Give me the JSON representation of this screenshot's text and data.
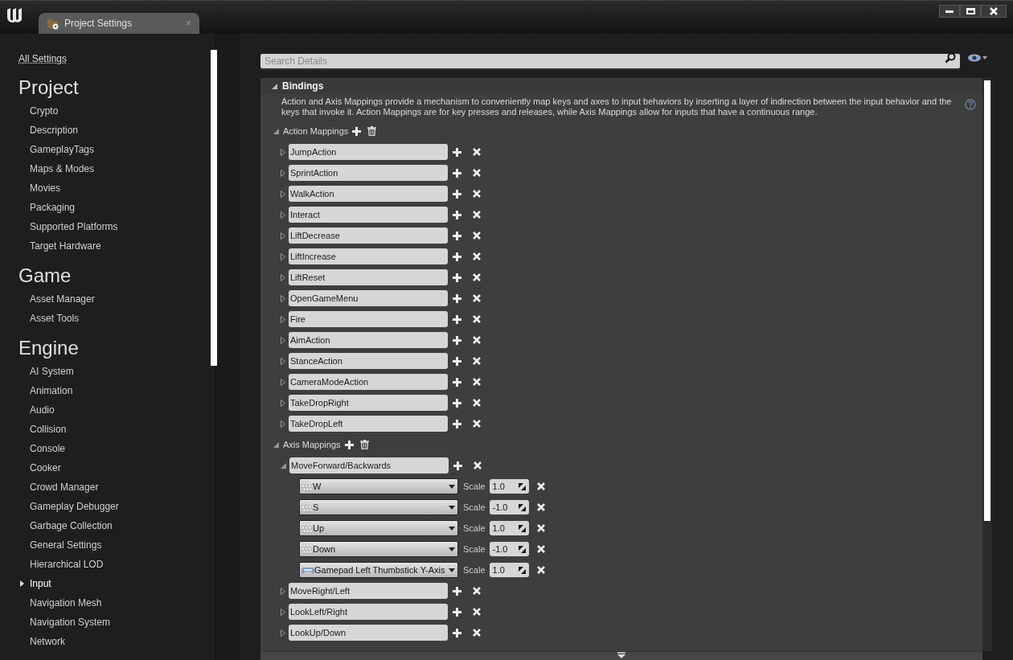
{
  "window": {
    "tab_title": "Project Settings",
    "tab_close": "×"
  },
  "sidebar": {
    "all_settings": "All Settings",
    "sections": [
      {
        "title": "Project",
        "items": [
          {
            "label": "Crypto",
            "selected": false
          },
          {
            "label": "Description",
            "selected": false
          },
          {
            "label": "GameplayTags",
            "selected": false
          },
          {
            "label": "Maps & Modes",
            "selected": false
          },
          {
            "label": "Movies",
            "selected": false
          },
          {
            "label": "Packaging",
            "selected": false
          },
          {
            "label": "Supported Platforms",
            "selected": false
          },
          {
            "label": "Target Hardware",
            "selected": false
          }
        ]
      },
      {
        "title": "Game",
        "items": [
          {
            "label": "Asset Manager",
            "selected": false
          },
          {
            "label": "Asset Tools",
            "selected": false
          }
        ]
      },
      {
        "title": "Engine",
        "items": [
          {
            "label": "AI System",
            "selected": false
          },
          {
            "label": "Animation",
            "selected": false
          },
          {
            "label": "Audio",
            "selected": false
          },
          {
            "label": "Collision",
            "selected": false
          },
          {
            "label": "Console",
            "selected": false
          },
          {
            "label": "Cooker",
            "selected": false
          },
          {
            "label": "Crowd Manager",
            "selected": false
          },
          {
            "label": "Gameplay Debugger",
            "selected": false
          },
          {
            "label": "Garbage Collection",
            "selected": false
          },
          {
            "label": "General Settings",
            "selected": false
          },
          {
            "label": "Hierarchical LOD",
            "selected": false
          },
          {
            "label": "Input",
            "selected": true
          },
          {
            "label": "Navigation Mesh",
            "selected": false
          },
          {
            "label": "Navigation System",
            "selected": false
          },
          {
            "label": "Network",
            "selected": false
          }
        ]
      }
    ]
  },
  "search": {
    "placeholder": "Search Details"
  },
  "bindings": {
    "title": "Bindings",
    "expanded": true,
    "description": "Action and Axis Mappings provide a mechanism to conveniently map keys and axes to input behaviors by inserting a layer of indirection between the input behavior and the keys that invoke it. Action Mappings are for key presses and releases, while Axis Mappings allow for inputs that have a continuous range.",
    "action_mappings": {
      "label": "Action Mappings",
      "expanded": true,
      "items": [
        {
          "name": "JumpAction",
          "expanded": false
        },
        {
          "name": "SprintAction",
          "expanded": false
        },
        {
          "name": "WalkAction",
          "expanded": false
        },
        {
          "name": "Interact",
          "expanded": false
        },
        {
          "name": "LiftDecrease",
          "expanded": false
        },
        {
          "name": "LiftIncrease",
          "expanded": false
        },
        {
          "name": "LiftReset",
          "expanded": false
        },
        {
          "name": "OpenGameMenu",
          "expanded": false
        },
        {
          "name": "Fire",
          "expanded": false
        },
        {
          "name": "AimAction",
          "expanded": false
        },
        {
          "name": "StanceAction",
          "expanded": false
        },
        {
          "name": "CameraModeAction",
          "expanded": false
        },
        {
          "name": "TakeDropRight",
          "expanded": false
        },
        {
          "name": "TakeDropLeft",
          "expanded": false
        }
      ]
    },
    "axis_mappings": {
      "label": "Axis Mappings",
      "expanded": true,
      "items": [
        {
          "name": "MoveForward/Backwards",
          "expanded": true,
          "keys": [
            {
              "key": "W",
              "kind": "keyboard",
              "scale_label": "Scale",
              "scale": "1.0"
            },
            {
              "key": "S",
              "kind": "keyboard",
              "scale_label": "Scale",
              "scale": "-1.0"
            },
            {
              "key": "Up",
              "kind": "keyboard",
              "scale_label": "Scale",
              "scale": "1.0"
            },
            {
              "key": "Down",
              "kind": "keyboard",
              "scale_label": "Scale",
              "scale": "-1.0"
            },
            {
              "key": "Gamepad Left Thumbstick Y-Axis",
              "kind": "gamepad",
              "scale_label": "Scale",
              "scale": "1.0"
            }
          ]
        },
        {
          "name": "MoveRight/Left",
          "expanded": false
        },
        {
          "name": "LookLeft/Right",
          "expanded": false
        },
        {
          "name": "LookUp/Down",
          "expanded": false
        }
      ]
    }
  }
}
